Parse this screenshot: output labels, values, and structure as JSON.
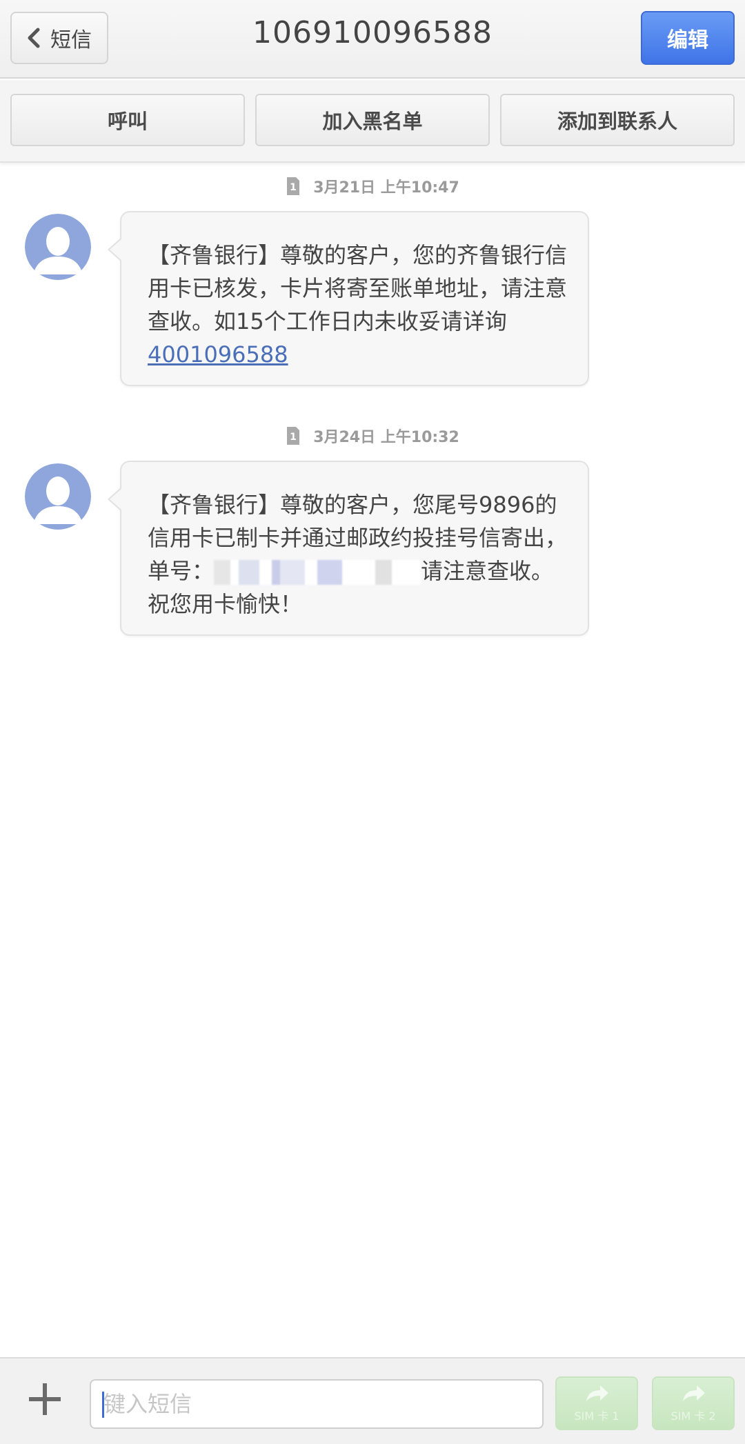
{
  "header": {
    "back_label": "短信",
    "title": "106910096588",
    "edit_label": "编辑"
  },
  "actions": {
    "call": "呼叫",
    "blacklist": "加入黑名单",
    "add_contact": "添加到联系人"
  },
  "messages": [
    {
      "timestamp": "3月21日 上午10:47",
      "sim": "1",
      "text": "【齐鲁银行】尊敬的客户，您的齐鲁银行信用卡已核发，卡片将寄至账单地址，请注意查收。如15个工作日内未收妥请详询",
      "link": "4001096588"
    },
    {
      "timestamp": "3月24日 上午10:32",
      "sim": "1",
      "text_before": "【齐鲁银行】尊敬的客户，您尾号9896的信用卡已制卡并通过邮政约投挂号信寄出，单号：",
      "text_after": "请注意查收。祝您用卡愉快！"
    }
  ],
  "composer": {
    "placeholder": "键入短信",
    "sim1_label": "SIM 卡 1",
    "sim2_label": "SIM 卡 2"
  },
  "colors": {
    "accent": "#4a7cf0",
    "link": "#4a6fb8",
    "send_disabled": "#cfe9c8"
  }
}
